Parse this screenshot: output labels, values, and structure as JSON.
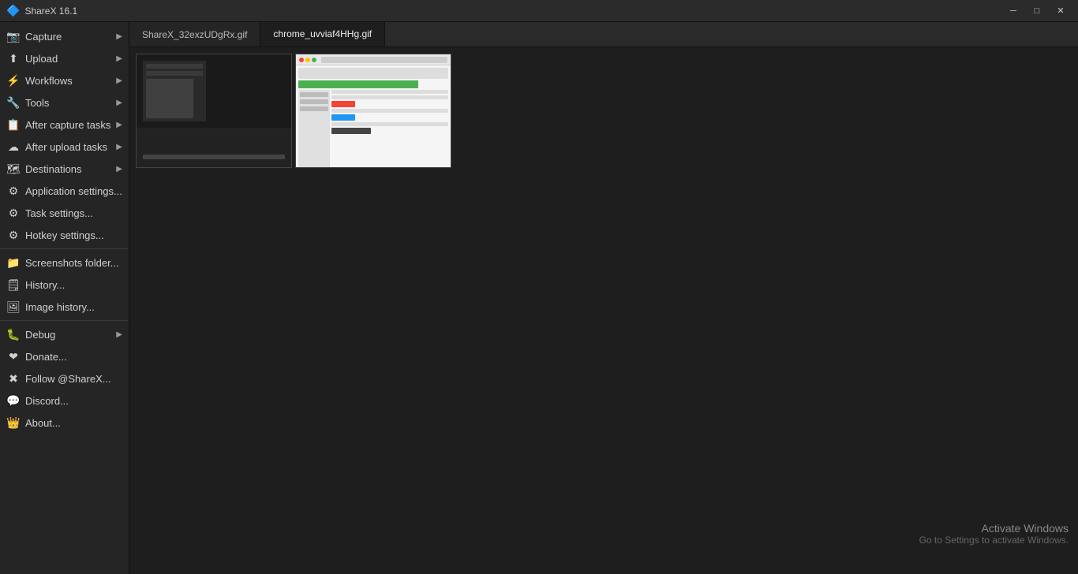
{
  "titlebar": {
    "title": "ShareX 16.1",
    "icon": "🔷",
    "minimize": "─",
    "maximize": "□",
    "close": "✕"
  },
  "menu": {
    "items": [
      {
        "id": "capture",
        "icon": "📷",
        "label": "Capture",
        "hasArrow": true
      },
      {
        "id": "upload",
        "icon": "⬆",
        "label": "Upload",
        "hasArrow": true
      },
      {
        "id": "workflows",
        "icon": "⚡",
        "label": "Workflows",
        "hasArrow": true
      },
      {
        "id": "tools",
        "icon": "🔧",
        "label": "Tools",
        "hasArrow": true
      },
      {
        "id": "after-capture",
        "icon": "📋",
        "label": "After capture tasks",
        "hasArrow": true
      },
      {
        "id": "after-upload",
        "icon": "☁",
        "label": "After upload tasks",
        "hasArrow": true
      },
      {
        "id": "destinations",
        "icon": "🗺",
        "label": "Destinations",
        "hasArrow": true
      },
      {
        "id": "app-settings",
        "icon": "⚙",
        "label": "Application settings...",
        "hasArrow": false
      },
      {
        "id": "task-settings",
        "icon": "⚙",
        "label": "Task settings...",
        "hasArrow": false
      },
      {
        "id": "hotkey-settings",
        "icon": "⚙",
        "label": "Hotkey settings...",
        "hasArrow": false
      },
      {
        "id": "sep1",
        "type": "separator"
      },
      {
        "id": "screenshots-folder",
        "icon": "📁",
        "label": "Screenshots folder...",
        "hasArrow": false
      },
      {
        "id": "history",
        "icon": "🗒",
        "label": "History...",
        "hasArrow": false
      },
      {
        "id": "image-history",
        "icon": "🖼",
        "label": "Image history...",
        "hasArrow": false
      },
      {
        "id": "sep2",
        "type": "separator"
      },
      {
        "id": "debug",
        "icon": "🐛",
        "label": "Debug",
        "hasArrow": true
      },
      {
        "id": "donate",
        "icon": "❤",
        "label": "Donate...",
        "hasArrow": false
      },
      {
        "id": "follow",
        "icon": "✖",
        "label": "Follow @ShareX...",
        "hasArrow": false
      },
      {
        "id": "discord",
        "icon": "💬",
        "label": "Discord...",
        "hasArrow": false
      },
      {
        "id": "about",
        "icon": "👑",
        "label": "About...",
        "hasArrow": false
      }
    ]
  },
  "tabs": [
    {
      "id": "tab1",
      "label": "ShareX_32exzUDgRx.gif",
      "active": false
    },
    {
      "id": "tab2",
      "label": "chrome_uvviaf4HHg.gif",
      "active": true
    }
  ],
  "activate_windows": {
    "line1": "Activate Windows",
    "line2": "Go to Settings to activate Windows."
  }
}
